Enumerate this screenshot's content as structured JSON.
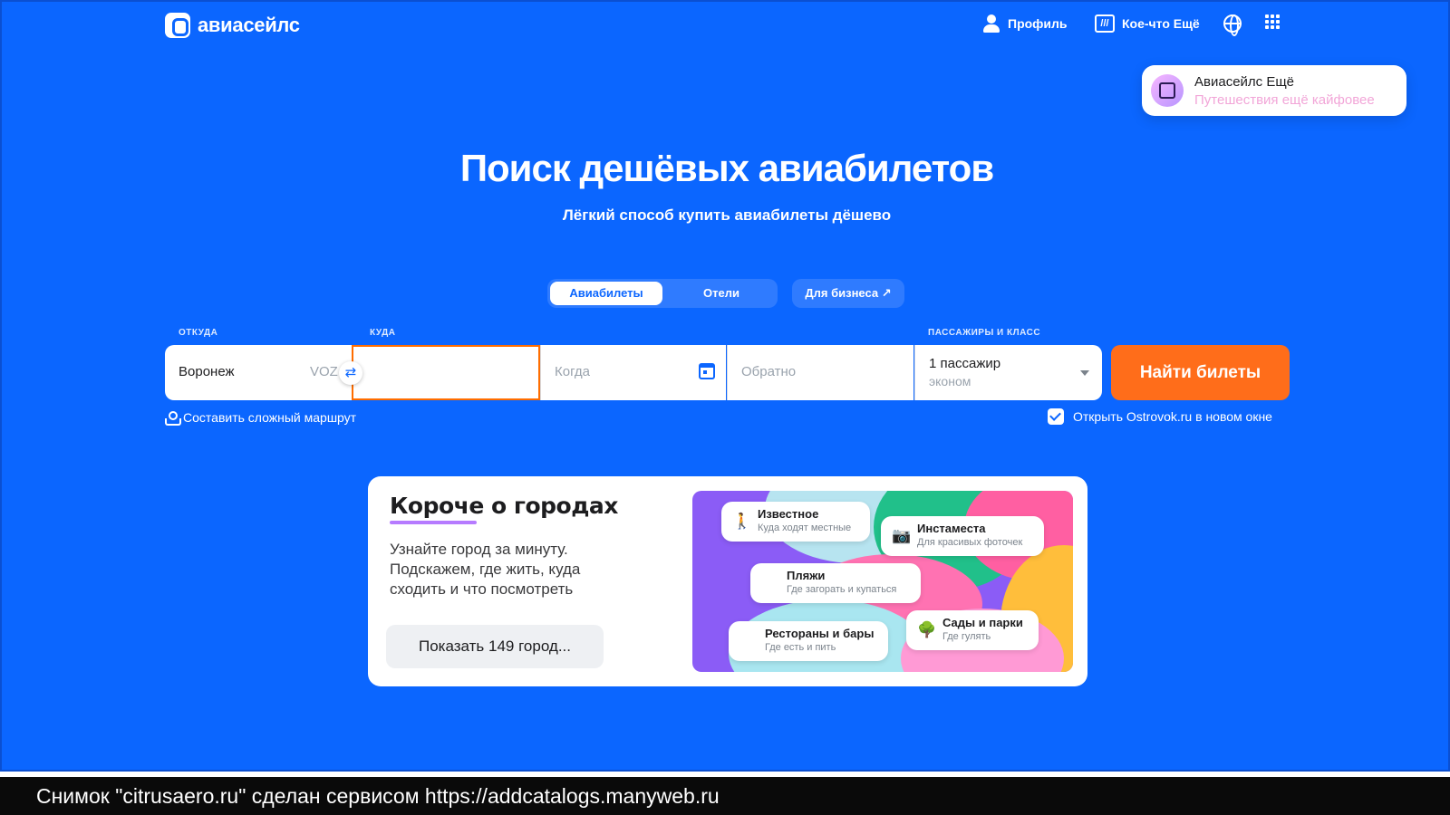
{
  "header": {
    "logo_text": "авиасейлс",
    "nav": {
      "profile": "Профиль",
      "more": "Кое-что Ещё"
    }
  },
  "promo": {
    "title": "Авиасейлс Ещё",
    "subtitle": "Путешествия ещё кайфовее"
  },
  "hero": {
    "title": "Поиск дешёвых авиабилетов",
    "subtitle": "Лёгкий способ купить авиабилеты дёшево"
  },
  "tabs": {
    "flights": "Авиабилеты",
    "hotels": "Отели",
    "business": "Для бизнеса ↗"
  },
  "search": {
    "labels": {
      "from": "ОТКУДА",
      "to": "КУДА",
      "passengers": "ПАССАЖИРЫ И КЛАСС"
    },
    "from_value": "Воронеж",
    "from_iata": "VOZ",
    "to_value": "",
    "when_placeholder": "Когда",
    "back_placeholder": "Обратно",
    "passengers_value": "1 пассажир",
    "class_value": "эконом",
    "find_button": "Найти билеты",
    "complex_route": "Составить сложный маршрут",
    "ostrovok_checkbox": "Открыть Ostrovok.ru в новом окне",
    "ostrovok_checked": true
  },
  "cities": {
    "title": "Короче о городах",
    "text": "Узнайте город за минуту. Подскажем, где жить, куда сходить и что посмотреть",
    "button": "Показать 149 город...",
    "chips": [
      {
        "title": "Известное",
        "sub": "Куда ходят местные",
        "icon": "🚶"
      },
      {
        "title": "Инстаместа",
        "sub": "Для красивых фоточек",
        "icon": "📷"
      },
      {
        "title": "Пляжи",
        "sub": "Где загорать и купаться",
        "icon": "🏖"
      },
      {
        "title": "Рестораны и бары",
        "sub": "Где есть и пить",
        "icon": "🍽"
      },
      {
        "title": "Сады и парки",
        "sub": "Где гулять",
        "icon": "🌳"
      }
    ]
  },
  "footer": {
    "caption": "Снимок \"citrusaero.ru\" сделан сервисом https://addcatalogs.manyweb.ru"
  },
  "colors": {
    "brand_blue": "#0b66ff",
    "accent_orange": "#ff6d1a",
    "highlight_purple": "#b67bff"
  }
}
